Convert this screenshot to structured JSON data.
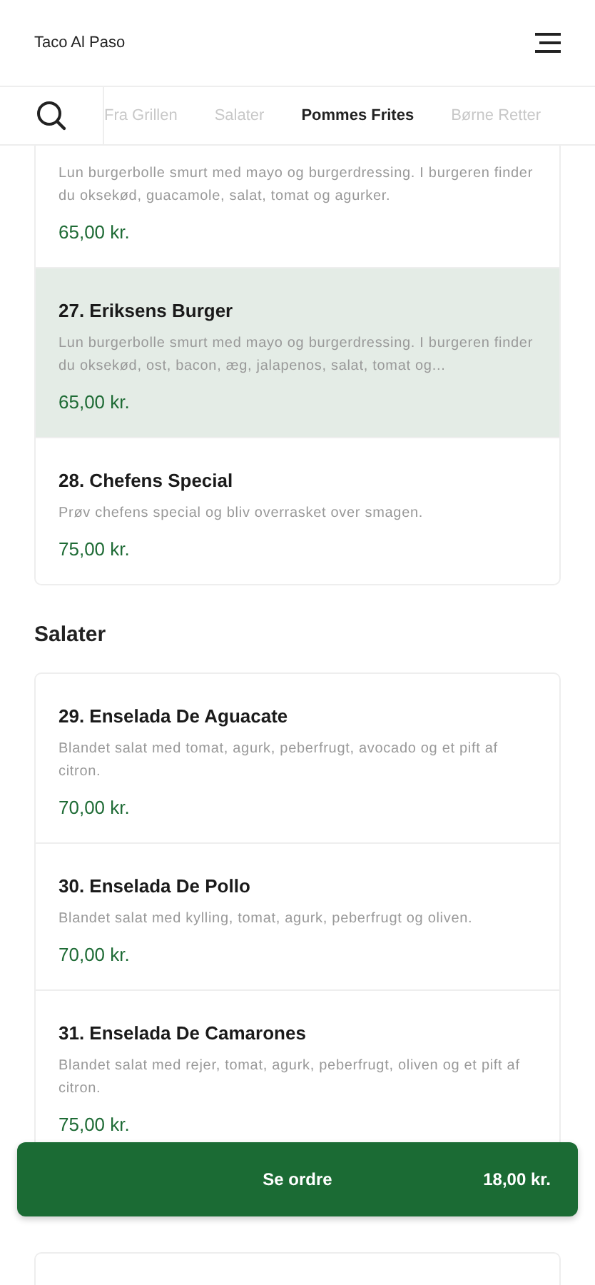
{
  "header": {
    "title": "Taco Al Paso"
  },
  "tabs": [
    {
      "label": "Fra Grillen",
      "selected": false
    },
    {
      "label": "Salater",
      "selected": false
    },
    {
      "label": "Pommes Frites",
      "selected": true
    },
    {
      "label": "Børne Retter",
      "selected": false
    }
  ],
  "sections": [
    {
      "items": [
        {
          "description": "Lun burgerbolle smurt med mayo og burgerdressing. I burgeren finder du oksekød, guacamole, salat, tomat og agurker.",
          "price": "65,00 kr.",
          "selected": false
        },
        {
          "name": "27. Eriksens Burger",
          "description": "Lun burgerbolle smurt med mayo og burgerdressing. I burgeren finder du oksekød, ost, bacon, æg, jalapenos, salat, tomat og...",
          "price": "65,00 kr.",
          "selected": true
        },
        {
          "name": "28. Chefens Special",
          "description": "Prøv chefens special og bliv overrasket over smagen.",
          "price": "75,00 kr.",
          "selected": false
        }
      ]
    },
    {
      "title": "Salater",
      "items": [
        {
          "name": "29. Enselada De Aguacate",
          "description": "Blandet salat med tomat, agurk, peberfrugt, avocado og et pift af citron.",
          "price": "70,00 kr.",
          "selected": false
        },
        {
          "name": "30. Enselada De Pollo",
          "description": "Blandet salat med kylling, tomat, agurk, peberfrugt og oliven.",
          "price": "70,00 kr.",
          "selected": false
        },
        {
          "name": "31. Enselada De Camarones",
          "description": "Blandet salat med rejer, tomat, agurk, peberfrugt, oliven og et pift af citron.",
          "price": "75,00 kr.",
          "selected": false
        }
      ]
    }
  ],
  "order_button": {
    "label": "Se ordre",
    "total": "18,00 kr."
  }
}
